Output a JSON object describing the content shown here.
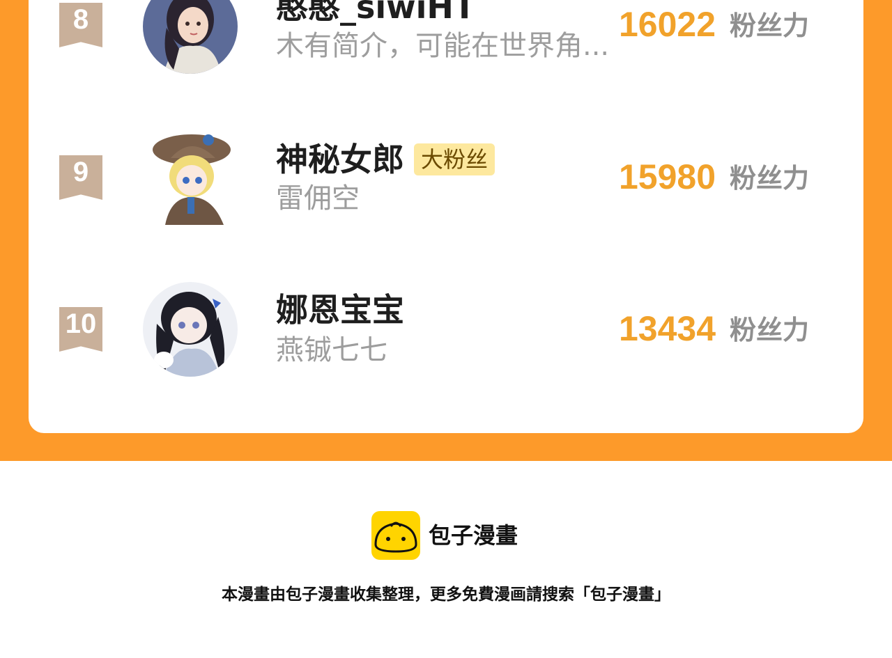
{
  "ranking": [
    {
      "rank": "8",
      "name": "憨憨_siwiHT",
      "badge": "",
      "description": "木有简介，可能在世界角...",
      "score": "16022",
      "score_unit": "粉丝力",
      "avatar_icon": "girl-portrait-avatar"
    },
    {
      "rank": "9",
      "name": "神秘女郎",
      "badge": "大粉丝",
      "description": "雷佣空",
      "score": "15980",
      "score_unit": "粉丝力",
      "avatar_icon": "detective-girl-avatar"
    },
    {
      "rank": "10",
      "name": "娜恩宝宝",
      "badge": "",
      "description": "燕铖七七",
      "score": "13434",
      "score_unit": "粉丝力",
      "avatar_icon": "anime-girl-bunny-avatar"
    }
  ],
  "footer": {
    "brand": "包子漫畫",
    "note": "本漫畫由包子漫畫收集整理，更多免費漫画請搜索「包子漫畫」"
  },
  "colors": {
    "background_orange": "#fd9a2a",
    "score_orange": "#f1a22b",
    "rank_ribbon": "#c9b09a",
    "badge_bg": "#fde89e",
    "logo_yellow": "#ffd400"
  }
}
